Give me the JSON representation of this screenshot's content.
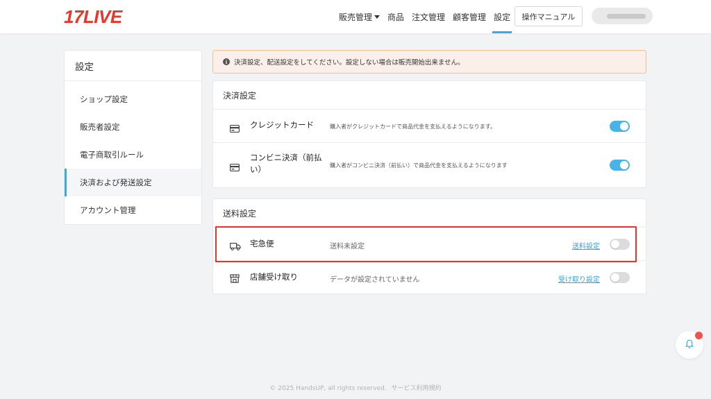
{
  "colors": {
    "brand_red": "#e8362b",
    "accent_blue": "#3aa9e0",
    "toggle_on": "#47b3e8",
    "toggle_off": "#dcdcde",
    "link_blue": "#3aa3d9",
    "highlight_red": "#e8322a",
    "badge_red": "#ef5350"
  },
  "header": {
    "logo": "17LIVE",
    "nav": [
      {
        "label": "販売管理",
        "has_dropdown": true
      },
      {
        "label": "商品"
      },
      {
        "label": "注文管理"
      },
      {
        "label": "顧客管理"
      },
      {
        "label": "設定",
        "active": true
      }
    ],
    "manual_button": "操作マニュアル",
    "user_avatar_icon": "user-icon"
  },
  "sidebar": {
    "title": "設定",
    "items": [
      {
        "label": "ショップ設定"
      },
      {
        "label": "販売者設定"
      },
      {
        "label": "電子商取引ルール"
      },
      {
        "label": "決済および発送設定",
        "active": true
      },
      {
        "label": "アカウント管理"
      }
    ]
  },
  "alert": {
    "icon": "info-icon",
    "text": "決済設定、配送設定をしてください。設定しない場合は販売開始出来ません。"
  },
  "payment": {
    "title": "決済設定",
    "rows": [
      {
        "icon": "credit-card-icon",
        "label": "クレジットカード",
        "description": "購入者がクレジットカードで商品代金を支払えるようになります。",
        "enabled": true
      },
      {
        "icon": "credit-card-icon",
        "label_line1": "コンビニ決済（前払",
        "label_line2": "い）",
        "description": "購入者がコンビニ決済（前払い）で商品代金を支払えるようになります",
        "enabled": true
      }
    ]
  },
  "shipping": {
    "title": "送料設定",
    "rows": [
      {
        "icon": "truck-icon",
        "label": "宅急便",
        "status": "送料未設定",
        "link": "送料設定",
        "enabled": false
      },
      {
        "icon": "store-icon",
        "label": "店舗受け取り",
        "status": "データが設定されていません",
        "link": "受け取り設定",
        "enabled": false
      }
    ]
  },
  "notification": {
    "icon": "bell-icon"
  },
  "footer": {
    "copyright": "© 2025 HandsUP, all rights reserved.",
    "terms": "サービス利用規約"
  }
}
